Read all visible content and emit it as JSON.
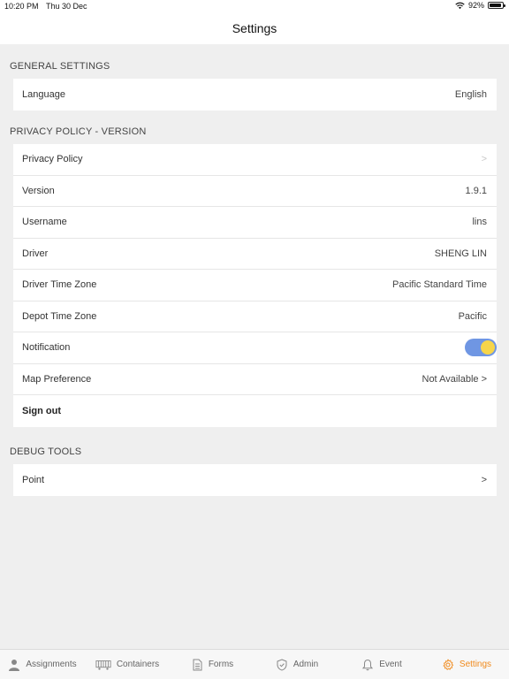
{
  "status_bar": {
    "time": "10:20 PM",
    "date": "Thu 30 Dec",
    "battery": "92%"
  },
  "header": {
    "title": "Settings"
  },
  "sections": {
    "general": {
      "title": "GENERAL SETTINGS",
      "rows": [
        {
          "label": "Language",
          "value": "English"
        }
      ]
    },
    "privacy": {
      "title": "PRIVACY POLICY - VERSION",
      "rows": [
        {
          "label": "Privacy Policy",
          "value": ">"
        },
        {
          "label": "Version",
          "value": "1.9.1"
        },
        {
          "label": "Username",
          "value": "lins"
        },
        {
          "label": "Driver",
          "value": "SHENG LIN"
        },
        {
          "label": "Driver Time Zone",
          "value": "Pacific Standard Time"
        },
        {
          "label": "Depot Time Zone",
          "value": "Pacific"
        },
        {
          "label": "Notification",
          "value": ""
        },
        {
          "label": "Map Preference",
          "value": "Not Available >"
        },
        {
          "label": "Sign out",
          "value": ""
        }
      ]
    },
    "debug": {
      "title": "DEBUG TOOLS",
      "rows": [
        {
          "label": "Point",
          "value": ">"
        }
      ]
    }
  },
  "notification_toggle": {
    "on": true,
    "track_color": "#6f96e3",
    "knob_color": "#f6d54a"
  },
  "tabs": [
    {
      "label": "Assignments",
      "icon": "person-icon"
    },
    {
      "label": "Containers",
      "icon": "container-icon"
    },
    {
      "label": "Forms",
      "icon": "document-icon"
    },
    {
      "label": "Admin",
      "icon": "shield-icon"
    },
    {
      "label": "Event",
      "icon": "bell-icon"
    },
    {
      "label": "Settings",
      "icon": "gear-icon",
      "active": true
    }
  ],
  "colors": {
    "accent": "#f08a1c",
    "background": "#efefef"
  }
}
